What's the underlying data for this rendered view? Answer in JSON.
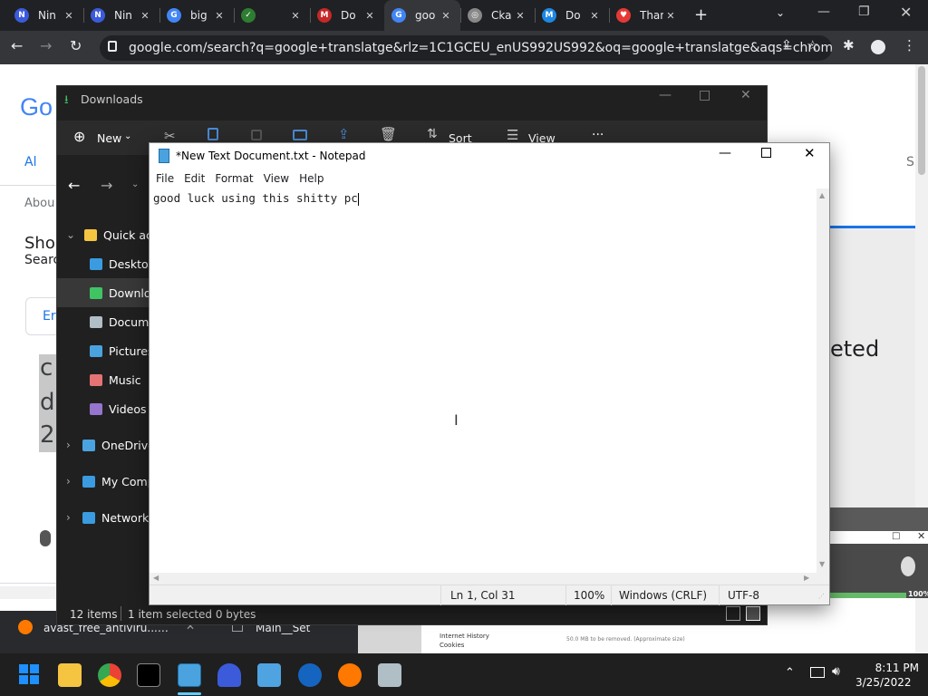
{
  "browser": {
    "tabs": [
      {
        "label": "Nin",
        "icon": "ninja-icon",
        "color": "#3b5bdb"
      },
      {
        "label": "Nin",
        "icon": "ninja-icon",
        "color": "#3b5bdb"
      },
      {
        "label": "big",
        "icon": "google-icon",
        "color": "#4285f4"
      },
      {
        "label": "",
        "icon": "checkmark-icon",
        "color": "#2e7d32"
      },
      {
        "label": "Do",
        "icon": "download-site-icon",
        "color": "#c62828"
      },
      {
        "label": "goo",
        "icon": "google-icon",
        "color": "#4285f4"
      },
      {
        "label": "Сka",
        "icon": "globe-icon",
        "color": "#888888"
      },
      {
        "label": "Do",
        "icon": "download-site-icon",
        "color": "#1e88e5"
      },
      {
        "label": "Thanks",
        "icon": "heart-icon",
        "color": "#e53935"
      }
    ],
    "url": "google.com/search?q=google+translatge&rlz=1C1GCEU_enUS992US992&oq=google+translatge&aqs=chrome..."
  },
  "google_page": {
    "logo": "Go",
    "tab_all": "Al",
    "about": "Abou",
    "show": "Sho",
    "search": "Searc",
    "lang_btn": "Er",
    "big_c": "c",
    "big_d": "d",
    "big_2": "2",
    "right_text": "eted",
    "right_s": "S"
  },
  "explorer": {
    "title": "Downloads",
    "new_label": "New",
    "sort_label": "Sort",
    "view_label": "View",
    "more_label": "···",
    "nav": [
      {
        "label": "Quick acc",
        "icon": "star-icon"
      },
      {
        "label": "Desktop",
        "icon": "desktop-icon"
      },
      {
        "label": "Downloa",
        "icon": "download-icon"
      },
      {
        "label": "Docume",
        "icon": "document-icon"
      },
      {
        "label": "Pictures",
        "icon": "pictures-icon"
      },
      {
        "label": "Music",
        "icon": "music-icon"
      },
      {
        "label": "Videos",
        "icon": "videos-icon"
      },
      {
        "label": "OneDrive",
        "icon": "cloud-icon"
      },
      {
        "label": "My Comp",
        "icon": "computer-icon"
      },
      {
        "label": "Network",
        "icon": "network-icon"
      }
    ],
    "status_items": "12 items",
    "status_selected": "1 item selected  0 bytes"
  },
  "notepad": {
    "title": "*New Text Document.txt - Notepad",
    "menu": [
      "File",
      "Edit",
      "Format",
      "View",
      "Help"
    ],
    "content": "good luck using this shitty pc",
    "status": {
      "pos": "Ln 1, Col 31",
      "zoom": "100%",
      "eol": "Windows (CRLF)",
      "enc": "UTF-8"
    }
  },
  "download_bar": {
    "item1": "avast_free_antiviru....exe",
    "item2": "Main__Set"
  },
  "background_window": {
    "items": [
      "Internet History",
      "Cookies"
    ],
    "note": "50.0 MB to be removed. (Approximate size)",
    "percent": "100%"
  },
  "taskbar": {
    "time": "8:11 PM",
    "date": "3/25/2022"
  }
}
